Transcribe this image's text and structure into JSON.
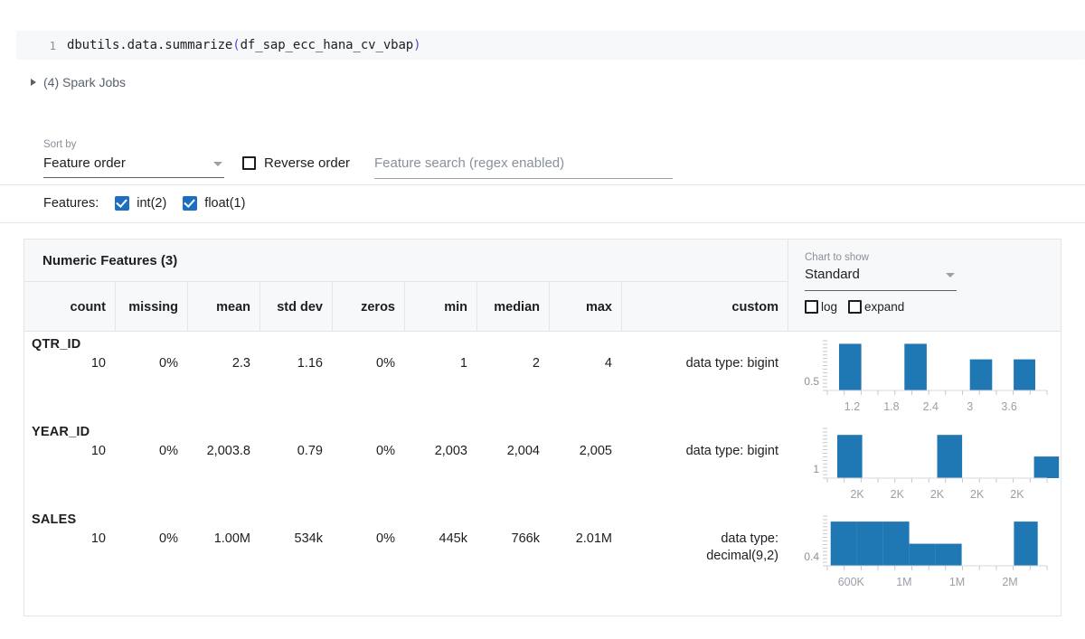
{
  "notebook": {
    "cell_number": "1",
    "code_prefix": "dbutils.data.summarize",
    "code_open_paren": "(",
    "code_arg": "df_sap_ecc_hana_cv_vbap",
    "code_close_paren": ")",
    "spark_jobs": "(4) Spark Jobs"
  },
  "controls": {
    "sort_by_label": "Sort by",
    "sort_by_value": "Feature order",
    "reverse_order_label": "Reverse order",
    "reverse_order_checked": false,
    "search_placeholder": "Feature search (regex enabled)",
    "search_value": "",
    "features_label": "Features:",
    "feature_types": [
      {
        "label": "int(2)",
        "checked": true
      },
      {
        "label": "float(1)",
        "checked": true
      }
    ]
  },
  "chart_panel": {
    "label": "Chart to show",
    "value": "Standard",
    "options": [
      "Standard"
    ],
    "log_label": "log",
    "log_checked": false,
    "expand_label": "expand",
    "expand_checked": false
  },
  "table": {
    "title": "Numeric Features (3)",
    "columns": [
      "count",
      "missing",
      "mean",
      "std dev",
      "zeros",
      "min",
      "median",
      "max",
      "custom"
    ],
    "rows": [
      {
        "feature": "QTR_ID",
        "count": "10",
        "missing": "0%",
        "mean": "2.3",
        "std_dev": "1.16",
        "zeros": "0%",
        "min": "1",
        "median": "2",
        "max": "4",
        "custom": "data type: bigint"
      },
      {
        "feature": "YEAR_ID",
        "count": "10",
        "missing": "0%",
        "mean": "2,003.8",
        "std_dev": "0.79",
        "zeros": "0%",
        "min": "2,003",
        "median": "2,004",
        "max": "2,005",
        "custom": "data type: bigint"
      },
      {
        "feature": "SALES",
        "count": "10",
        "missing": "0%",
        "mean": "1.00M",
        "std_dev": "534k",
        "zeros": "0%",
        "min": "445k",
        "median": "766k",
        "max": "2.01M",
        "custom": "data type: decimal(9,2)"
      }
    ]
  },
  "accent_color": "#1f77b4",
  "checkbox_color": "#1b6ec2",
  "chart_data": [
    {
      "type": "bar",
      "title": "QTR_ID histogram",
      "feature": "QTR_ID",
      "xlabel": "",
      "ylabel": "",
      "ytick_labels": [
        "0.5"
      ],
      "ytick_values": [
        0.5
      ],
      "ylim": [
        0,
        3.2
      ],
      "xtick_labels": [
        "1.2",
        "1.8",
        "2.4",
        "3",
        "3.6"
      ],
      "xtick_values": [
        1.2,
        1.8,
        2.4,
        3.0,
        3.6
      ],
      "xlim": [
        0.82,
        4.18
      ],
      "grid": false,
      "bin_edges": [
        1.0,
        1.34,
        1.67,
        2.0,
        2.34,
        2.67,
        3.0,
        3.34,
        3.67,
        4.0
      ],
      "categories": [
        "1",
        "2",
        "3",
        "4"
      ],
      "values": [
        3,
        3,
        2,
        2
      ],
      "bars": [
        {
          "x0": 1.0,
          "x1": 1.34,
          "height": 3
        },
        {
          "x0": 2.0,
          "x1": 2.34,
          "height": 3
        },
        {
          "x0": 3.0,
          "x1": 3.34,
          "height": 2
        },
        {
          "x0": 3.67,
          "x1": 4.0,
          "height": 2
        }
      ]
    },
    {
      "type": "bar",
      "title": "YEAR_ID histogram",
      "feature": "YEAR_ID",
      "xlabel": "",
      "ylabel": "",
      "ytick_labels": [
        "1"
      ],
      "ytick_values": [
        1
      ],
      "ylim": [
        0,
        4.6
      ],
      "xtick_labels": [
        "2K",
        "2K",
        "2K",
        "2K",
        "2K"
      ],
      "xtick_values": [
        2003.2,
        2003.6,
        2004.0,
        2004.4,
        2004.8
      ],
      "xlim": [
        2002.9,
        2005.1
      ],
      "grid": false,
      "bin_edges": [
        2003.0,
        2003.25,
        2004.0,
        2004.25,
        2005.0,
        2005.25
      ],
      "categories": [
        "2003",
        "2004",
        "2005"
      ],
      "values": [
        4,
        4,
        2
      ],
      "bars": [
        {
          "x0": 2003.0,
          "x1": 2003.25,
          "height": 4
        },
        {
          "x0": 2004.0,
          "x1": 2004.25,
          "height": 4
        },
        {
          "x0": 2004.97,
          "x1": 2005.22,
          "height": 2
        }
      ]
    },
    {
      "type": "bar",
      "title": "SALES histogram",
      "feature": "SALES",
      "xlabel": "",
      "ylabel": "",
      "ytick_labels": [
        "0.4"
      ],
      "ytick_values": [
        0.4
      ],
      "ylim": [
        0,
        2.25
      ],
      "xtick_labels": [
        "600K",
        "1M",
        "1M",
        "2M"
      ],
      "xtick_values": [
        600000,
        1000000,
        1400000,
        1800000
      ],
      "xlim": [
        420000,
        2080000
      ],
      "grid": false,
      "bin_edges": [
        445000,
        643000,
        841000,
        1039000,
        1237000,
        1435000,
        2010000
      ],
      "values": [
        2,
        2,
        2,
        1,
        1,
        0,
        0,
        0,
        2
      ],
      "bars": [
        {
          "x0": 445000,
          "x1": 643000,
          "height": 2
        },
        {
          "x0": 643000,
          "x1": 841000,
          "height": 2
        },
        {
          "x0": 841000,
          "x1": 1039000,
          "height": 2
        },
        {
          "x0": 1039000,
          "x1": 1237000,
          "height": 1
        },
        {
          "x0": 1237000,
          "x1": 1435000,
          "height": 1
        },
        {
          "x0": 1830000,
          "x1": 2010000,
          "height": 2
        }
      ]
    }
  ]
}
